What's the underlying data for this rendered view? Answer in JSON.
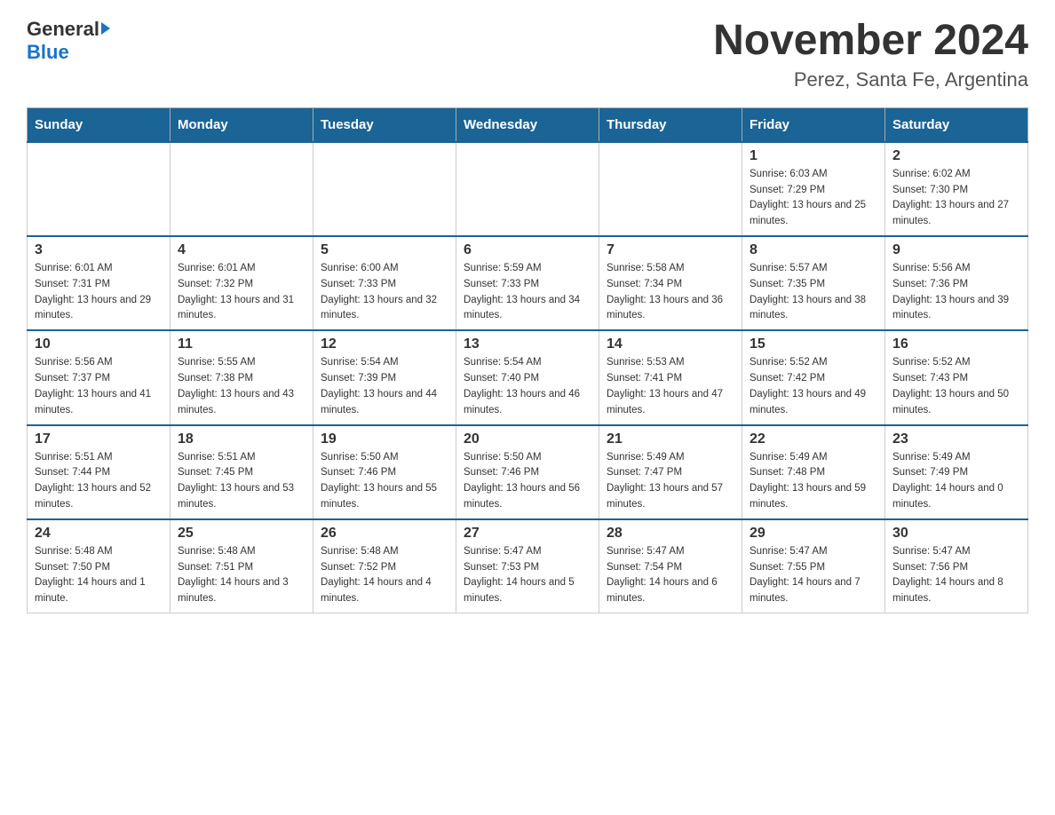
{
  "header": {
    "logo_general": "General",
    "logo_blue": "Blue",
    "title": "November 2024",
    "subtitle": "Perez, Santa Fe, Argentina"
  },
  "days_of_week": [
    "Sunday",
    "Monday",
    "Tuesday",
    "Wednesday",
    "Thursday",
    "Friday",
    "Saturday"
  ],
  "weeks": [
    [
      {
        "day": "",
        "info": ""
      },
      {
        "day": "",
        "info": ""
      },
      {
        "day": "",
        "info": ""
      },
      {
        "day": "",
        "info": ""
      },
      {
        "day": "",
        "info": ""
      },
      {
        "day": "1",
        "info": "Sunrise: 6:03 AM\nSunset: 7:29 PM\nDaylight: 13 hours and 25 minutes."
      },
      {
        "day": "2",
        "info": "Sunrise: 6:02 AM\nSunset: 7:30 PM\nDaylight: 13 hours and 27 minutes."
      }
    ],
    [
      {
        "day": "3",
        "info": "Sunrise: 6:01 AM\nSunset: 7:31 PM\nDaylight: 13 hours and 29 minutes."
      },
      {
        "day": "4",
        "info": "Sunrise: 6:01 AM\nSunset: 7:32 PM\nDaylight: 13 hours and 31 minutes."
      },
      {
        "day": "5",
        "info": "Sunrise: 6:00 AM\nSunset: 7:33 PM\nDaylight: 13 hours and 32 minutes."
      },
      {
        "day": "6",
        "info": "Sunrise: 5:59 AM\nSunset: 7:33 PM\nDaylight: 13 hours and 34 minutes."
      },
      {
        "day": "7",
        "info": "Sunrise: 5:58 AM\nSunset: 7:34 PM\nDaylight: 13 hours and 36 minutes."
      },
      {
        "day": "8",
        "info": "Sunrise: 5:57 AM\nSunset: 7:35 PM\nDaylight: 13 hours and 38 minutes."
      },
      {
        "day": "9",
        "info": "Sunrise: 5:56 AM\nSunset: 7:36 PM\nDaylight: 13 hours and 39 minutes."
      }
    ],
    [
      {
        "day": "10",
        "info": "Sunrise: 5:56 AM\nSunset: 7:37 PM\nDaylight: 13 hours and 41 minutes."
      },
      {
        "day": "11",
        "info": "Sunrise: 5:55 AM\nSunset: 7:38 PM\nDaylight: 13 hours and 43 minutes."
      },
      {
        "day": "12",
        "info": "Sunrise: 5:54 AM\nSunset: 7:39 PM\nDaylight: 13 hours and 44 minutes."
      },
      {
        "day": "13",
        "info": "Sunrise: 5:54 AM\nSunset: 7:40 PM\nDaylight: 13 hours and 46 minutes."
      },
      {
        "day": "14",
        "info": "Sunrise: 5:53 AM\nSunset: 7:41 PM\nDaylight: 13 hours and 47 minutes."
      },
      {
        "day": "15",
        "info": "Sunrise: 5:52 AM\nSunset: 7:42 PM\nDaylight: 13 hours and 49 minutes."
      },
      {
        "day": "16",
        "info": "Sunrise: 5:52 AM\nSunset: 7:43 PM\nDaylight: 13 hours and 50 minutes."
      }
    ],
    [
      {
        "day": "17",
        "info": "Sunrise: 5:51 AM\nSunset: 7:44 PM\nDaylight: 13 hours and 52 minutes."
      },
      {
        "day": "18",
        "info": "Sunrise: 5:51 AM\nSunset: 7:45 PM\nDaylight: 13 hours and 53 minutes."
      },
      {
        "day": "19",
        "info": "Sunrise: 5:50 AM\nSunset: 7:46 PM\nDaylight: 13 hours and 55 minutes."
      },
      {
        "day": "20",
        "info": "Sunrise: 5:50 AM\nSunset: 7:46 PM\nDaylight: 13 hours and 56 minutes."
      },
      {
        "day": "21",
        "info": "Sunrise: 5:49 AM\nSunset: 7:47 PM\nDaylight: 13 hours and 57 minutes."
      },
      {
        "day": "22",
        "info": "Sunrise: 5:49 AM\nSunset: 7:48 PM\nDaylight: 13 hours and 59 minutes."
      },
      {
        "day": "23",
        "info": "Sunrise: 5:49 AM\nSunset: 7:49 PM\nDaylight: 14 hours and 0 minutes."
      }
    ],
    [
      {
        "day": "24",
        "info": "Sunrise: 5:48 AM\nSunset: 7:50 PM\nDaylight: 14 hours and 1 minute."
      },
      {
        "day": "25",
        "info": "Sunrise: 5:48 AM\nSunset: 7:51 PM\nDaylight: 14 hours and 3 minutes."
      },
      {
        "day": "26",
        "info": "Sunrise: 5:48 AM\nSunset: 7:52 PM\nDaylight: 14 hours and 4 minutes."
      },
      {
        "day": "27",
        "info": "Sunrise: 5:47 AM\nSunset: 7:53 PM\nDaylight: 14 hours and 5 minutes."
      },
      {
        "day": "28",
        "info": "Sunrise: 5:47 AM\nSunset: 7:54 PM\nDaylight: 14 hours and 6 minutes."
      },
      {
        "day": "29",
        "info": "Sunrise: 5:47 AM\nSunset: 7:55 PM\nDaylight: 14 hours and 7 minutes."
      },
      {
        "day": "30",
        "info": "Sunrise: 5:47 AM\nSunset: 7:56 PM\nDaylight: 14 hours and 8 minutes."
      }
    ]
  ]
}
